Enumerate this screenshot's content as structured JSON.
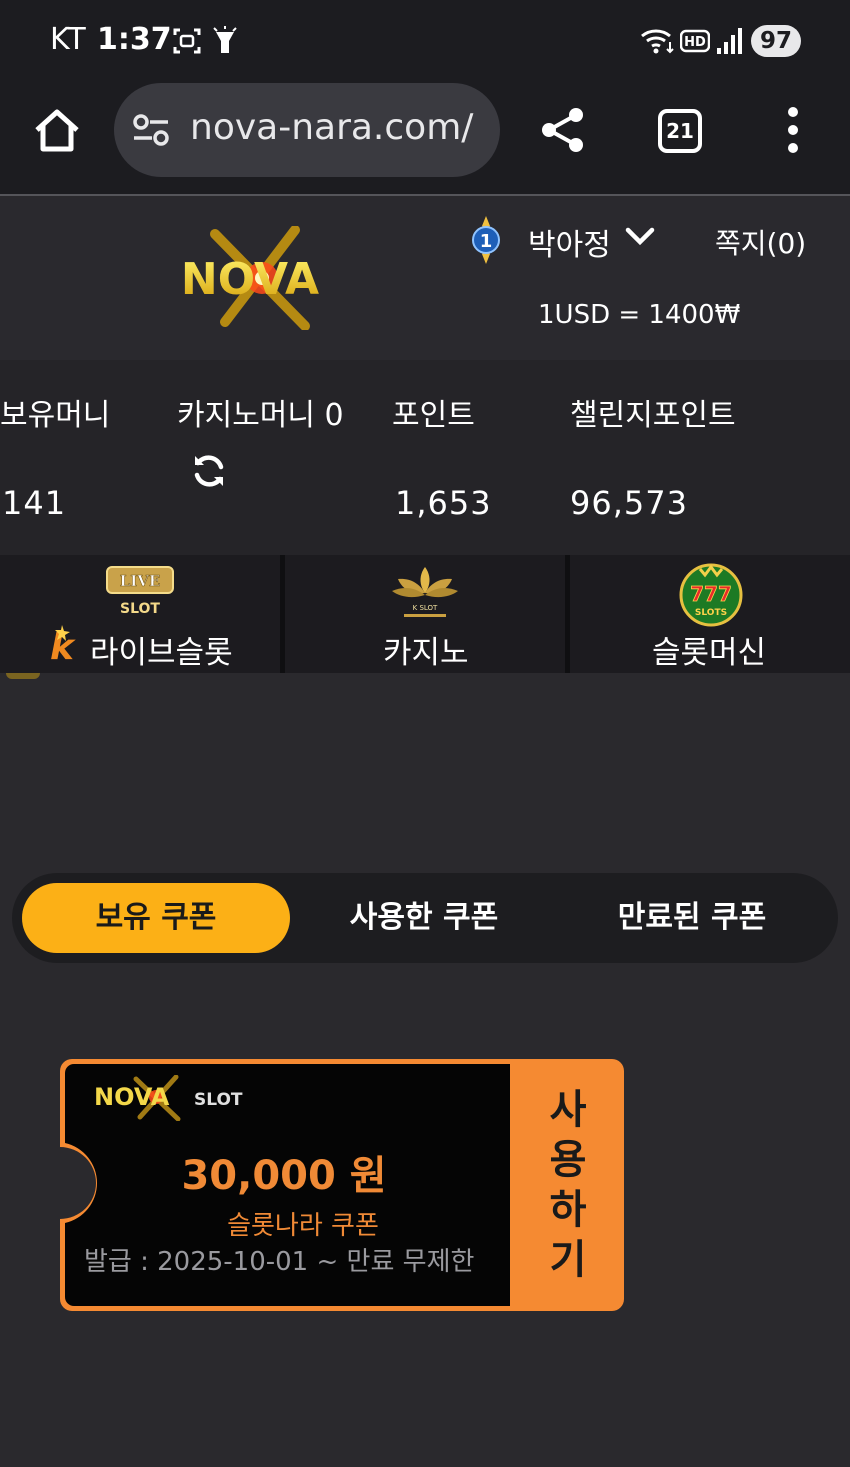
{
  "status_bar": {
    "carrier": "KT",
    "time": "1:37",
    "battery": "97",
    "icons": [
      "screenshot-icon",
      "flashlight-icon",
      "wifi-icon",
      "hd-icon",
      "signal-icon"
    ]
  },
  "browser": {
    "url": "nova-nara.com/",
    "tab_count": "21",
    "icons": [
      "home-icon",
      "site-settings-icon",
      "share-icon",
      "tabs-icon",
      "more-vert-icon"
    ]
  },
  "header": {
    "logo_text": "NOVA",
    "rank_level": "1",
    "username": "박아정",
    "messages": "쪽지(0)",
    "exchange_rate": "1USD = 1400₩"
  },
  "balances": {
    "holding": {
      "label": "보유머니",
      "value": "141"
    },
    "casino": {
      "label": "카지노머니 0"
    },
    "points": {
      "label": "포인트",
      "value": "1,653"
    },
    "challenge": {
      "label": "챌린지포인트",
      "value": "96,573"
    }
  },
  "game_nav": [
    {
      "label": "라이브슬롯",
      "icon_text": "LIVE",
      "icon_sub": "SLOT",
      "k_mark": "k"
    },
    {
      "label": "카지노",
      "icon_text": "K SLOT"
    },
    {
      "label": "슬롯머신",
      "icon_text": "777",
      "icon_sub": "SLOTS"
    }
  ],
  "coupon_tabs": [
    {
      "label": "보유 쿠폰",
      "active": true
    },
    {
      "label": "사용한 쿠폰",
      "active": false
    },
    {
      "label": "만료된 쿠폰",
      "active": false
    }
  ],
  "coupon": {
    "brand": "NOVA",
    "brand_sub": "SLOT",
    "amount": "30,000 원",
    "name": "슬롯나라 쿠폰",
    "period": "발급 : 2025-10-01 ~ 만료 무제한",
    "use_chars": [
      "사",
      "용",
      "하",
      "기"
    ]
  },
  "colors": {
    "accent": "#fcb016",
    "coupon_orange": "#f58a32",
    "background": "#2a292d"
  }
}
